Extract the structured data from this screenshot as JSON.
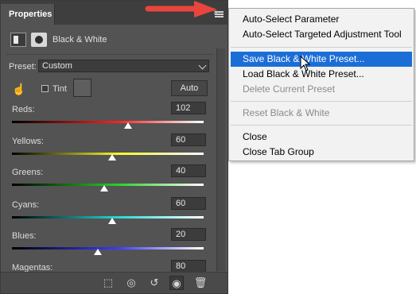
{
  "panel": {
    "tab_title": "Properties",
    "adjustment_title": "Black & White",
    "preset_label": "Preset:",
    "preset_value": "Custom",
    "tint_label": "Tint",
    "auto_label": "Auto",
    "sliders": [
      {
        "label": "Reds:",
        "value": "102"
      },
      {
        "label": "Yellows:",
        "value": "60"
      },
      {
        "label": "Greens:",
        "value": "40"
      },
      {
        "label": "Cyans:",
        "value": "60"
      },
      {
        "label": "Blues:",
        "value": "20"
      },
      {
        "label": "Magentas:",
        "value": "80"
      }
    ],
    "slider_gradients": [
      [
        "#000000",
        "#ff2020"
      ],
      [
        "#000000",
        "#f5f52a"
      ],
      [
        "#000000",
        "#27d027"
      ],
      [
        "#000000",
        "#26d6d6"
      ],
      [
        "#000000",
        "#3a3aff"
      ],
      [
        "#000000",
        "#e33ae3"
      ]
    ],
    "footer_icons": [
      "clip-to-layer-icon",
      "view-previous-state-icon",
      "reset-icon",
      "visibility-eye-icon",
      "trash-icon"
    ]
  },
  "menu": {
    "items": [
      {
        "label": "Auto-Select Parameter",
        "state": "normal"
      },
      {
        "label": "Auto-Select Targeted Adjustment Tool",
        "state": "normal"
      },
      {
        "label": "Save Black & White Preset...",
        "state": "selected"
      },
      {
        "label": "Load Black & White Preset...",
        "state": "normal"
      },
      {
        "label": "Delete Current Preset",
        "state": "disabled"
      },
      {
        "label": "Reset Black & White",
        "state": "disabled"
      },
      {
        "label": "Close",
        "state": "normal"
      },
      {
        "label": "Close Tab Group",
        "state": "normal"
      }
    ]
  },
  "colors": {
    "accent_selected": "#1c6ed7",
    "annotation_arrow": "#e8453c"
  }
}
